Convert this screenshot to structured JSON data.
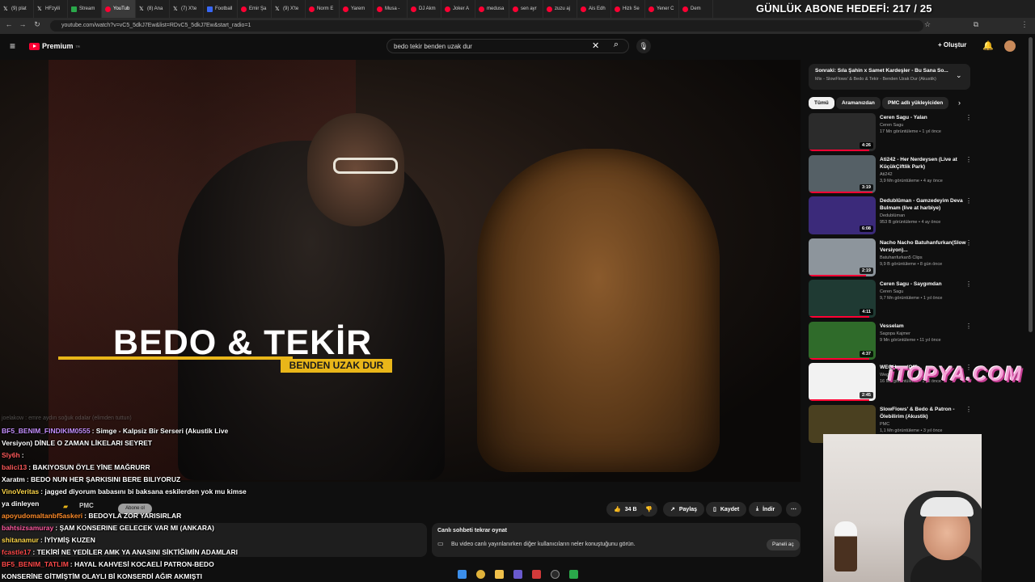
{
  "browser": {
    "tabs": [
      {
        "label": "(9) plat",
        "icon": "x-logo"
      },
      {
        "label": "HFzyili",
        "icon": "x-logo"
      },
      {
        "label": "Stream",
        "icon": "green-square"
      },
      {
        "label": "YouTub",
        "icon": "youtube"
      },
      {
        "label": "(8) Ana",
        "icon": "x-logo"
      },
      {
        "label": "(7) X'te",
        "icon": "x-logo"
      },
      {
        "label": "Football",
        "icon": "blue-square"
      },
      {
        "label": "Emir Şa",
        "icon": "youtube"
      },
      {
        "label": "(9) X'te",
        "icon": "x-logo"
      },
      {
        "label": "Norm E",
        "icon": "youtube"
      },
      {
        "label": "Yarem",
        "icon": "youtube"
      },
      {
        "label": "Musa -",
        "icon": "youtube"
      },
      {
        "label": "DJ Akm",
        "icon": "youtube"
      },
      {
        "label": "Joker A",
        "icon": "youtube"
      },
      {
        "label": "medusa",
        "icon": "youtube"
      },
      {
        "label": "sen ayr",
        "icon": "youtube"
      },
      {
        "label": "zuzu aj",
        "icon": "youtube"
      },
      {
        "label": "Ais Edh",
        "icon": "youtube"
      },
      {
        "label": "Hizlı Se",
        "icon": "youtube"
      },
      {
        "label": "Yener C",
        "icon": "youtube"
      },
      {
        "label": "Dem",
        "icon": "youtube"
      }
    ],
    "url": "youtube.com/watch?v=vC5_5dkJ7Ew&list=RDvC5_5dkJ7Ew&start_radio=1"
  },
  "overlay": {
    "goal": "GÜNLÜK ABONE HEDEFİ: 217 / 25",
    "watermark": "iTOPYA.COM"
  },
  "masthead": {
    "logo": "Premium",
    "logo_sup": "TR",
    "search_value": "bedo tekir benden uzak dur",
    "create_label": "Oluştur"
  },
  "video": {
    "title_big": "BEDO & TEKİR",
    "subtitle": "BENDEN UZAK DUR"
  },
  "actions": {
    "like_count": "34 B",
    "share": "Paylaş",
    "save": "Kaydet",
    "download": "İndir"
  },
  "channel": {
    "name": "PMC",
    "subscribe_label": "Abone ol"
  },
  "live_chat": {
    "title": "Canlı sohbeti tekrar oynat",
    "description": "Bu video canlı yayınlanırken diğer kullanıcıların neler konuştuğunu görün.",
    "button": "Paneli aç"
  },
  "sidebar": {
    "next_up": {
      "title": "Sonraki: Sıla Şahin x Samet Kardeşler - Bu Sana So...",
      "subtitle": "Mix - SlowFlows' & Bedo & Tekir - Benden Uzak Dur (Akustik)"
    },
    "chips": [
      "Tümü",
      "Aramanızdan",
      "PMC adlı yükleyiciden"
    ],
    "videos": [
      {
        "title": "Ceren Sagu - Yalan",
        "channel": "Ceren Sagu",
        "meta": "17 Mn görüntüleme • 1 yıl önce",
        "duration": "4:26",
        "progress": 0.9,
        "thumb": "#2b2b2b"
      },
      {
        "title": "Ati242 - Her Nerdeysen (Live at KüçükÇiftlik Park)",
        "channel": "Ati242",
        "meta": "3,9 Mn görüntüleme • 4 ay önce",
        "duration": "3:19",
        "progress": 0.95,
        "thumb": "#556066"
      },
      {
        "title": "Dedublüman - Gamzedeyim Deva Bulmam (live at harbiye)",
        "channel": "Dedublüman",
        "meta": "953 B görüntüleme • 4 ay önce",
        "duration": "6:08",
        "progress": 0.0,
        "thumb": "#3b2a7a"
      },
      {
        "title": "Nacho Nacho Batuhanfurkan(Slow Versiyon)...",
        "channel": "Batuhanfurkan5 Clips",
        "meta": "9,9 B görüntüleme • 8 gün önce",
        "duration": "2:19",
        "progress": 0.85,
        "thumb": "#8d959c"
      },
      {
        "title": "Ceren Sagu - Saygımdan",
        "channel": "Ceren Sagu",
        "meta": "9,7 Mn görüntüleme • 1 yıl önce",
        "duration": "4:11",
        "progress": 0.9,
        "thumb": "#1f3a33"
      },
      {
        "title": "Vesselam",
        "channel": "Sagopa Kajmer",
        "meta": "9 Mn görüntüleme • 11 yıl önce",
        "duration": "4:37",
        "progress": 0.9,
        "thumb": "#2f6b2a"
      },
      {
        "title": "WEGH - ... (Offi...",
        "channel": "Wegh",
        "meta": "16 Mn görüntüleme • 1 yıl önce",
        "duration": "2:45",
        "progress": 0.9,
        "thumb": "#f2f2f2"
      },
      {
        "title": "SlowFlows' & Bedo & Patron - Ölebilirim (Akustik)",
        "channel": "PMC",
        "meta": "1,1 Mn görüntüleme • 3 yıl önce",
        "duration": "",
        "progress": 0.0,
        "thumb": "#4a4020"
      }
    ]
  },
  "chat": [
    {
      "user": "",
      "text": "joelakow : emre aydın soğuk odalar (elimden tuttun)",
      "color": "#9a9a9a",
      "faded": true
    },
    {
      "user": "BF5_BENIM_FINDIKIM0555",
      "text": ": Simge - Kalpsiz Bir Serseri (Akustik Live",
      "color": "#c690ff"
    },
    {
      "user": "",
      "text": "Versiyon) DİNLE O ZAMAN LİKELARI SEYRET",
      "color": "#ffffff"
    },
    {
      "user": "Sly6h",
      "text": ":",
      "color": "#ff5a5a"
    },
    {
      "user": "balici13",
      "text": ": BAKIYOSUN ÖYLE YİNE MAĞRURR",
      "color": "#ff5a5a"
    },
    {
      "user": "Xaratm",
      "text": ": BEDO NUN HER ŞARKISINI      BERE BILIYORUZ",
      "color": "#ffffff"
    },
    {
      "user": "VinoVeritas",
      "text": ": jagged diyorum babasını bi baksana eskilerden yok mu kimse",
      "color": "#ffd84a"
    },
    {
      "user": "",
      "text": "ya dinleyen",
      "color": "#ffffff"
    },
    {
      "user": "apoyudomaltanbf5askeri",
      "text": ": BEDOYLA ZOR YARISIRLAR",
      "color": "#ff8c2a"
    },
    {
      "user": "bahtsizsamuray",
      "text": ": ŞAM KONSERINE GELECEK VAR MI (ANKARA)",
      "color": "#ff5aa0"
    },
    {
      "user": "shitanamur",
      "text": ": İYİYMİŞ KUZEN",
      "color": "#ffd84a"
    },
    {
      "user": "fcastle17",
      "text": ": TEKİRİ NE YEDİLER AMK YA ANASINI SİKTİĞİMİN ADAMLARI",
      "color": "#ff4a4a"
    },
    {
      "user": "BF5_BENIM_TATLIM",
      "text": ": HAYAL KAHVESİ KOCAELİ PATRON-BEDO",
      "color": "#ff4a4a"
    },
    {
      "user": "",
      "text": "KONSERİNE GİTMİŞTİM OLAYLI Bİ KONSERDİ AĞIR AKMIŞTI",
      "color": "#ffffff"
    }
  ]
}
